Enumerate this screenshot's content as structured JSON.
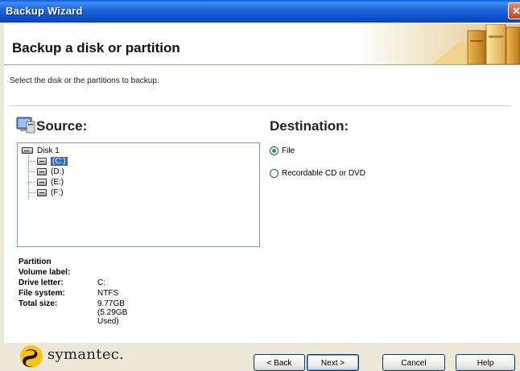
{
  "window": {
    "title": "Backup Wizard",
    "close_glyph": "✕"
  },
  "header": {
    "heading": "Backup a disk or partition"
  },
  "instructions": "Select the disk or the partitions to backup.",
  "source": {
    "label": "Source:",
    "tree": {
      "disk": "Disk 1",
      "partitions": [
        "(C:)",
        "(D:)",
        "(E:)",
        "(F:)"
      ],
      "selected": "(C:)"
    }
  },
  "destination": {
    "label": "Destination:",
    "options": [
      {
        "label": "File",
        "checked": true
      },
      {
        "label": "Recordable CD or DVD",
        "checked": false
      }
    ]
  },
  "partition_info": {
    "heading": "Partition",
    "volume_label": {
      "key": "Volume label:",
      "value": ""
    },
    "drive_letter": {
      "key": "Drive letter:",
      "value": "C:"
    },
    "file_system": {
      "key": "File system:",
      "value": "NTFS"
    },
    "total_size": {
      "key": "Total size:",
      "value": "9.77GB (5.29GB Used)"
    }
  },
  "footer": {
    "brand": "symantec.",
    "buttons": {
      "back": "< Back",
      "next": "Next >",
      "cancel": "Cancel",
      "help": "Help"
    }
  },
  "colors": {
    "titlebar": "#0A4CC6",
    "selection": "#316AC5",
    "radio_dot": "#21A121",
    "brand_yellow": "#FFC20E"
  }
}
